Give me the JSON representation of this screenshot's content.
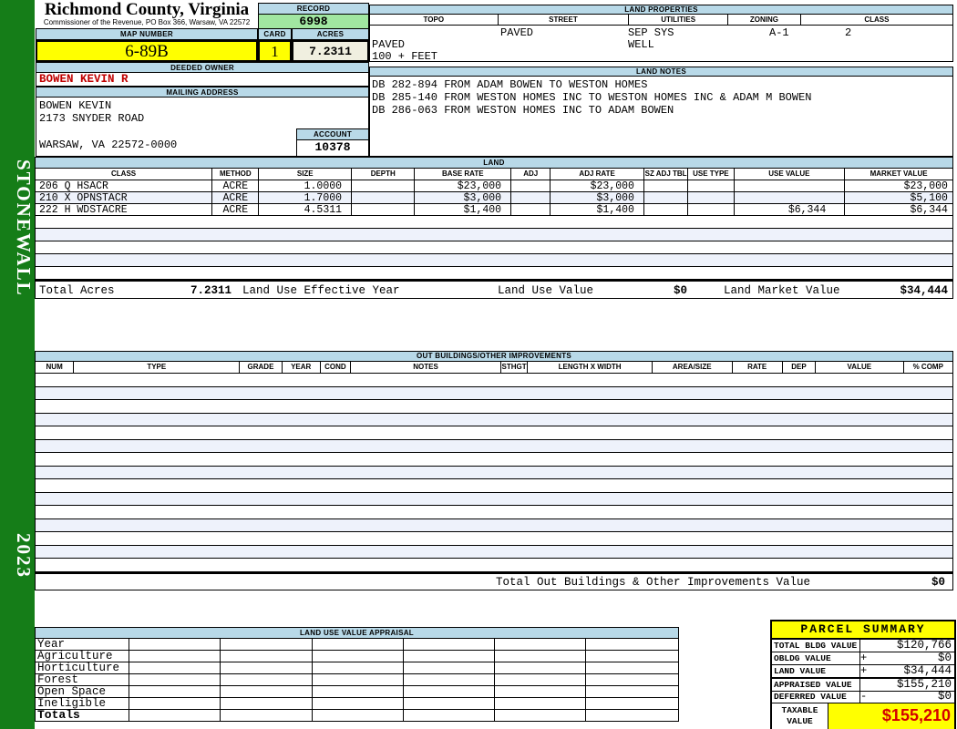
{
  "sidebar": {
    "district": "STONEWALL",
    "year": "2023"
  },
  "header": {
    "county": "Richmond County, Virginia",
    "commissioner_line": "Commissioner of the Revenue, PO Box 366, Warsaw, VA 22572",
    "record_label": "RECORD",
    "record_value": "6998",
    "map_number_label": "MAP NUMBER",
    "map_number_value": "6-89B",
    "card_label": "CARD",
    "card_value": "1",
    "acres_label": "ACRES",
    "acres_value": "7.2311"
  },
  "land_properties": {
    "title": "LAND PROPERTIES",
    "columns": [
      "TOPO",
      "STREET",
      "UTILITIES",
      "ZONING",
      "CLASS"
    ],
    "row1": {
      "street": "PAVED",
      "utilities": "SEP SYS",
      "zoning": "A-1",
      "class": "2"
    },
    "row2": {
      "left": "PAVED",
      "utilities": "WELL"
    },
    "row3": {
      "left": "100 + FEET"
    }
  },
  "owner": {
    "deeded_owner_label": "DEEDED OWNER",
    "deeded_owner": "BOWEN KEVIN R",
    "mailing_label": "MAILING ADDRESS",
    "mailing_lines": [
      "BOWEN KEVIN",
      "2173 SNYDER ROAD",
      "WARSAW, VA 22572-0000"
    ],
    "account_label": "ACCOUNT",
    "account_value": "10378"
  },
  "land_notes": {
    "title": "LAND NOTES",
    "lines": [
      "DB 282-894 FROM ADAM BOWEN TO WESTON HOMES",
      "DB 285-140 FROM WESTON HOMES INC TO WESTON HOMES INC & ADAM M BOWEN",
      "DB 286-063 FROM WESTON HOMES INC TO ADAM BOWEN"
    ]
  },
  "land": {
    "title": "LAND",
    "columns": [
      "CLASS",
      "METHOD",
      "SIZE",
      "DEPTH",
      "BASE RATE",
      "ADJ",
      "ADJ RATE",
      "SZ ADJ TBL",
      "USE TYPE",
      "USE VALUE",
      "MARKET VALUE"
    ],
    "rows": [
      [
        "206 Q HSACR",
        "ACRE",
        "1.0000",
        "",
        "$23,000",
        "",
        "$23,000",
        "",
        "",
        "",
        "$23,000"
      ],
      [
        "210 X OPNSTACR",
        "ACRE",
        "1.7000",
        "",
        "$3,000",
        "",
        "$3,000",
        "",
        "",
        "",
        "$5,100"
      ],
      [
        "222 H WDSTACRE",
        "ACRE",
        "4.5311",
        "",
        "$1,400",
        "",
        "$1,400",
        "",
        "",
        "$6,344",
        "$6,344"
      ]
    ],
    "empty_row_count": 5,
    "totals": {
      "total_acres_label": "Total Acres",
      "total_acres": "7.2311",
      "effective_year_label": "Land Use Effective Year",
      "use_value_label": "Land Use Value",
      "use_value": "$0",
      "market_value_label": "Land Market Value",
      "market_value": "$34,444"
    }
  },
  "out_buildings": {
    "title": "OUT BUILDINGS/OTHER IMPROVEMENTS",
    "columns": [
      "NUM",
      "TYPE",
      "GRADE",
      "YEAR",
      "COND",
      "NOTES",
      "STHGT",
      "LENGTH X WIDTH",
      "AREA/SIZE",
      "RATE",
      "DEP",
      "VALUE",
      "% COMP"
    ],
    "empty_row_count": 15,
    "total_label": "Total Out Buildings & Other Improvements Value",
    "total_value": "$0"
  },
  "land_use_appraisal": {
    "title": "LAND USE VALUE APPRAISAL",
    "row_labels": [
      "Year",
      "Agriculture",
      "Horticulture",
      "Forest",
      "Open Space",
      "Ineligible",
      "Totals"
    ],
    "column_count": 6
  },
  "parcel_summary": {
    "title": "PARCEL SUMMARY",
    "rows": [
      {
        "label": "TOTAL BLDG VALUE",
        "op": "",
        "value": "$120,766"
      },
      {
        "label": "OBLDG VALUE",
        "op": "+",
        "value": "$0"
      },
      {
        "label": "LAND VALUE",
        "op": "+",
        "value": "$34,444"
      },
      {
        "label": "APPRAISED VALUE",
        "op": "",
        "value": "$155,210"
      },
      {
        "label": "DEFERRED VALUE",
        "op": "-",
        "value": "$0"
      }
    ],
    "taxable_label_line1": "TAXABLE",
    "taxable_label_line2": "VALUE",
    "taxable_value": "$155,210"
  },
  "colors": {
    "sidebar_green": "#157d18",
    "header_blue": "#b8d9e8",
    "record_green": "#a1e7a1",
    "highlight_yellow": "#ffff00",
    "acres_cream": "#f0efe0",
    "owner_red": "#c00000",
    "taxable_red": "#d40000"
  }
}
